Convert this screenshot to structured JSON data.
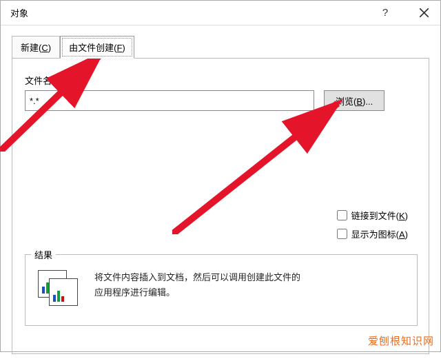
{
  "titlebar": {
    "title": "对象",
    "help": "?",
    "close": "×"
  },
  "tabs": {
    "new": {
      "label": "新建",
      "accel": "C"
    },
    "fromfile": {
      "label": "由文件创建",
      "accel": "F"
    }
  },
  "filename": {
    "label": "文件名",
    "accel": "N",
    "value": "*.*"
  },
  "browse": {
    "label": "浏览",
    "accel": "B",
    "suffix": "..."
  },
  "checkboxes": {
    "link": {
      "label": "链接到文件",
      "accel": "K"
    },
    "icon": {
      "label": "显示为图标",
      "accel": "A"
    }
  },
  "result": {
    "legend": "结果",
    "text": "将文件内容插入到文档，然后可以调用创建此文件的应用程序进行编辑。"
  },
  "watermark": "爱刨根知识网"
}
